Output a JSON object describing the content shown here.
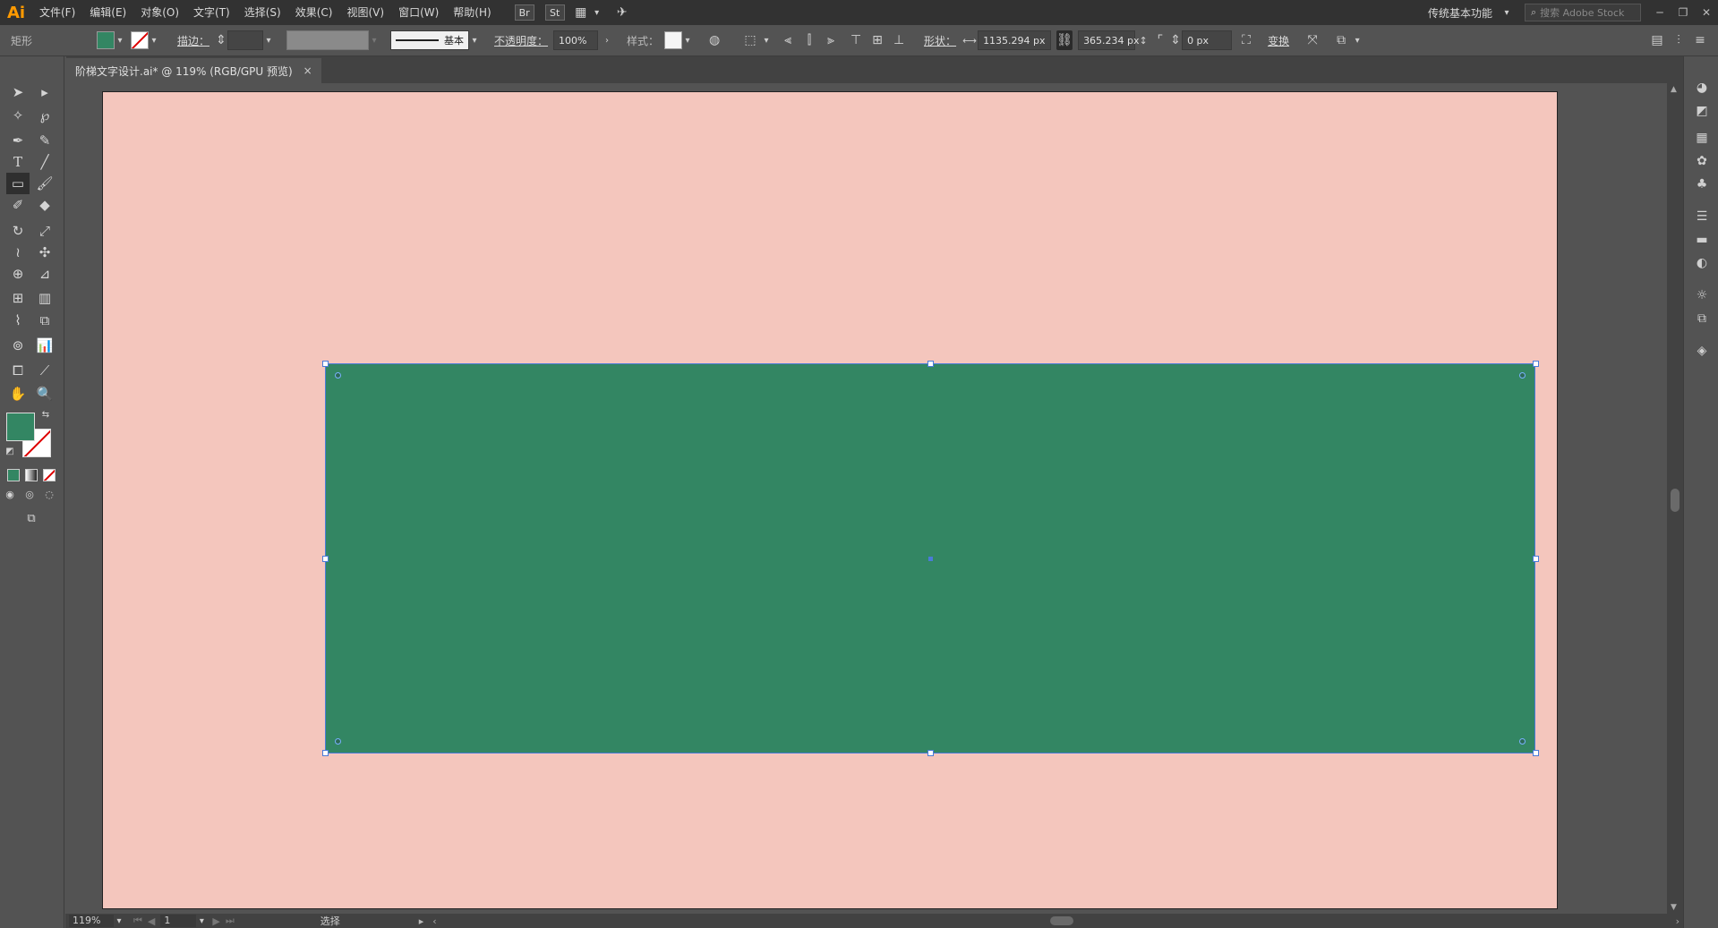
{
  "app": {
    "logo": "Ai"
  },
  "menu": {
    "items": [
      {
        "label": "文件(F)"
      },
      {
        "label": "编辑(E)"
      },
      {
        "label": "对象(O)"
      },
      {
        "label": "文字(T)"
      },
      {
        "label": "选择(S)"
      },
      {
        "label": "效果(C)"
      },
      {
        "label": "视图(V)"
      },
      {
        "label": "窗口(W)"
      },
      {
        "label": "帮助(H)"
      }
    ],
    "bridge_label": "Br",
    "stock_label": "St",
    "workspace": "传统基本功能",
    "search_placeholder": "搜索 Adobe Stock"
  },
  "control": {
    "selection_type": "矩形",
    "stroke_label": "描边：",
    "stroke_profile": "基本",
    "opacity_label": "不透明度：",
    "opacity_value": "100%",
    "style_label": "样式：",
    "shape_label": "形状：",
    "width_value": "1135.294 px",
    "height_value": "365.234 px",
    "corner_value": "0 px",
    "transform_label": "变换",
    "fill_color": "#338663"
  },
  "document": {
    "tab_title": "阶梯文字设计.ai* @ 119% (RGB/GPU 预览)",
    "close_glyph": "×"
  },
  "canvas": {
    "artboard_color": "#f4c6bd",
    "rect_color": "#338663",
    "selection_color": "#4a7bd8"
  },
  "status": {
    "zoom": "119%",
    "artboard_number": "1",
    "tool_status": "选择"
  }
}
